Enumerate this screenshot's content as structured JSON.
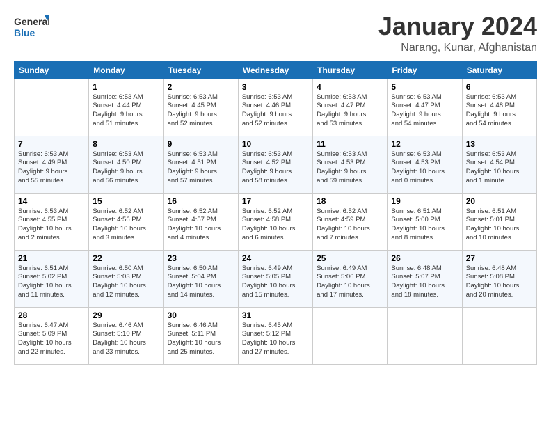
{
  "logo": {
    "general": "General",
    "blue": "Blue"
  },
  "title": "January 2024",
  "location": "Narang, Kunar, Afghanistan",
  "headers": [
    "Sunday",
    "Monday",
    "Tuesday",
    "Wednesday",
    "Thursday",
    "Friday",
    "Saturday"
  ],
  "weeks": [
    [
      {
        "day": "",
        "info": ""
      },
      {
        "day": "1",
        "info": "Sunrise: 6:53 AM\nSunset: 4:44 PM\nDaylight: 9 hours\nand 51 minutes."
      },
      {
        "day": "2",
        "info": "Sunrise: 6:53 AM\nSunset: 4:45 PM\nDaylight: 9 hours\nand 52 minutes."
      },
      {
        "day": "3",
        "info": "Sunrise: 6:53 AM\nSunset: 4:46 PM\nDaylight: 9 hours\nand 52 minutes."
      },
      {
        "day": "4",
        "info": "Sunrise: 6:53 AM\nSunset: 4:47 PM\nDaylight: 9 hours\nand 53 minutes."
      },
      {
        "day": "5",
        "info": "Sunrise: 6:53 AM\nSunset: 4:47 PM\nDaylight: 9 hours\nand 54 minutes."
      },
      {
        "day": "6",
        "info": "Sunrise: 6:53 AM\nSunset: 4:48 PM\nDaylight: 9 hours\nand 54 minutes."
      }
    ],
    [
      {
        "day": "7",
        "info": "Sunrise: 6:53 AM\nSunset: 4:49 PM\nDaylight: 9 hours\nand 55 minutes."
      },
      {
        "day": "8",
        "info": "Sunrise: 6:53 AM\nSunset: 4:50 PM\nDaylight: 9 hours\nand 56 minutes."
      },
      {
        "day": "9",
        "info": "Sunrise: 6:53 AM\nSunset: 4:51 PM\nDaylight: 9 hours\nand 57 minutes."
      },
      {
        "day": "10",
        "info": "Sunrise: 6:53 AM\nSunset: 4:52 PM\nDaylight: 9 hours\nand 58 minutes."
      },
      {
        "day": "11",
        "info": "Sunrise: 6:53 AM\nSunset: 4:53 PM\nDaylight: 9 hours\nand 59 minutes."
      },
      {
        "day": "12",
        "info": "Sunrise: 6:53 AM\nSunset: 4:53 PM\nDaylight: 10 hours\nand 0 minutes."
      },
      {
        "day": "13",
        "info": "Sunrise: 6:53 AM\nSunset: 4:54 PM\nDaylight: 10 hours\nand 1 minute."
      }
    ],
    [
      {
        "day": "14",
        "info": "Sunrise: 6:53 AM\nSunset: 4:55 PM\nDaylight: 10 hours\nand 2 minutes."
      },
      {
        "day": "15",
        "info": "Sunrise: 6:52 AM\nSunset: 4:56 PM\nDaylight: 10 hours\nand 3 minutes."
      },
      {
        "day": "16",
        "info": "Sunrise: 6:52 AM\nSunset: 4:57 PM\nDaylight: 10 hours\nand 4 minutes."
      },
      {
        "day": "17",
        "info": "Sunrise: 6:52 AM\nSunset: 4:58 PM\nDaylight: 10 hours\nand 6 minutes."
      },
      {
        "day": "18",
        "info": "Sunrise: 6:52 AM\nSunset: 4:59 PM\nDaylight: 10 hours\nand 7 minutes."
      },
      {
        "day": "19",
        "info": "Sunrise: 6:51 AM\nSunset: 5:00 PM\nDaylight: 10 hours\nand 8 minutes."
      },
      {
        "day": "20",
        "info": "Sunrise: 6:51 AM\nSunset: 5:01 PM\nDaylight: 10 hours\nand 10 minutes."
      }
    ],
    [
      {
        "day": "21",
        "info": "Sunrise: 6:51 AM\nSunset: 5:02 PM\nDaylight: 10 hours\nand 11 minutes."
      },
      {
        "day": "22",
        "info": "Sunrise: 6:50 AM\nSunset: 5:03 PM\nDaylight: 10 hours\nand 12 minutes."
      },
      {
        "day": "23",
        "info": "Sunrise: 6:50 AM\nSunset: 5:04 PM\nDaylight: 10 hours\nand 14 minutes."
      },
      {
        "day": "24",
        "info": "Sunrise: 6:49 AM\nSunset: 5:05 PM\nDaylight: 10 hours\nand 15 minutes."
      },
      {
        "day": "25",
        "info": "Sunrise: 6:49 AM\nSunset: 5:06 PM\nDaylight: 10 hours\nand 17 minutes."
      },
      {
        "day": "26",
        "info": "Sunrise: 6:48 AM\nSunset: 5:07 PM\nDaylight: 10 hours\nand 18 minutes."
      },
      {
        "day": "27",
        "info": "Sunrise: 6:48 AM\nSunset: 5:08 PM\nDaylight: 10 hours\nand 20 minutes."
      }
    ],
    [
      {
        "day": "28",
        "info": "Sunrise: 6:47 AM\nSunset: 5:09 PM\nDaylight: 10 hours\nand 22 minutes."
      },
      {
        "day": "29",
        "info": "Sunrise: 6:46 AM\nSunset: 5:10 PM\nDaylight: 10 hours\nand 23 minutes."
      },
      {
        "day": "30",
        "info": "Sunrise: 6:46 AM\nSunset: 5:11 PM\nDaylight: 10 hours\nand 25 minutes."
      },
      {
        "day": "31",
        "info": "Sunrise: 6:45 AM\nSunset: 5:12 PM\nDaylight: 10 hours\nand 27 minutes."
      },
      {
        "day": "",
        "info": ""
      },
      {
        "day": "",
        "info": ""
      },
      {
        "day": "",
        "info": ""
      }
    ]
  ]
}
